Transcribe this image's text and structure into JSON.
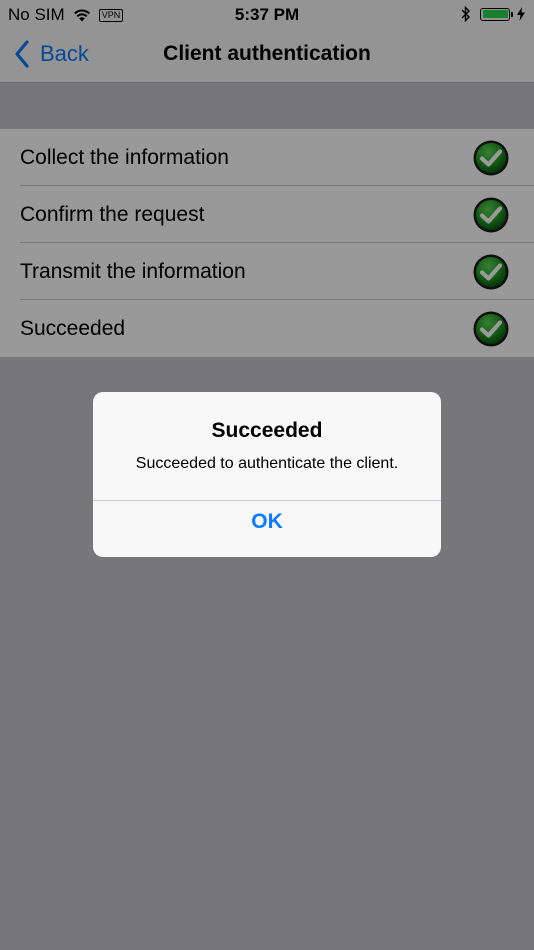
{
  "status_bar": {
    "carrier": "No SIM",
    "vpn": "VPN",
    "time": "5:37 PM",
    "battery_color": "#2bd84e"
  },
  "nav": {
    "back_label": "Back",
    "title": "Client authentication",
    "accent_color": "#0a7aff"
  },
  "steps": [
    {
      "label": "Collect the information",
      "icon": "check-circle-icon"
    },
    {
      "label": "Confirm the request",
      "icon": "check-circle-icon"
    },
    {
      "label": "Transmit the information",
      "icon": "check-circle-icon"
    },
    {
      "label": "Succeeded",
      "icon": "check-circle-icon"
    }
  ],
  "alert": {
    "title": "Succeeded",
    "message": "Succeeded to authenticate the client.",
    "ok_label": "OK"
  }
}
